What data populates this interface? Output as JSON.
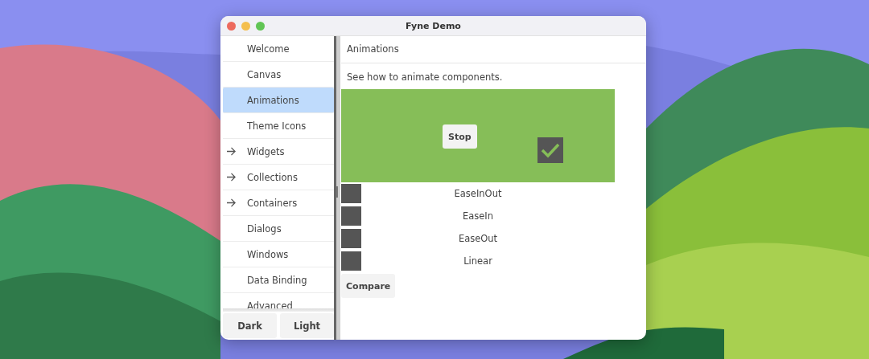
{
  "window": {
    "title": "Fyne Demo"
  },
  "sidebar": {
    "items": [
      {
        "label": "Welcome",
        "expandable": false,
        "selected": false
      },
      {
        "label": "Canvas",
        "expandable": false,
        "selected": false
      },
      {
        "label": "Animations",
        "expandable": false,
        "selected": true
      },
      {
        "label": "Theme Icons",
        "expandable": false,
        "selected": false
      },
      {
        "label": "Widgets",
        "expandable": true,
        "selected": false
      },
      {
        "label": "Collections",
        "expandable": true,
        "selected": false
      },
      {
        "label": "Containers",
        "expandable": true,
        "selected": false
      },
      {
        "label": "Dialogs",
        "expandable": false,
        "selected": false
      },
      {
        "label": "Windows",
        "expandable": false,
        "selected": false
      },
      {
        "label": "Data Binding",
        "expandable": false,
        "selected": false
      },
      {
        "label": "Advanced",
        "expandable": false,
        "selected": false
      }
    ],
    "buttons": [
      "Dark",
      "Light"
    ]
  },
  "content": {
    "title": "Animations",
    "description": "See how to animate components.",
    "stop_button": "Stop",
    "checked": true,
    "easings": [
      "EaseInOut",
      "EaseIn",
      "EaseOut",
      "Linear"
    ],
    "compare_button": "Compare"
  }
}
